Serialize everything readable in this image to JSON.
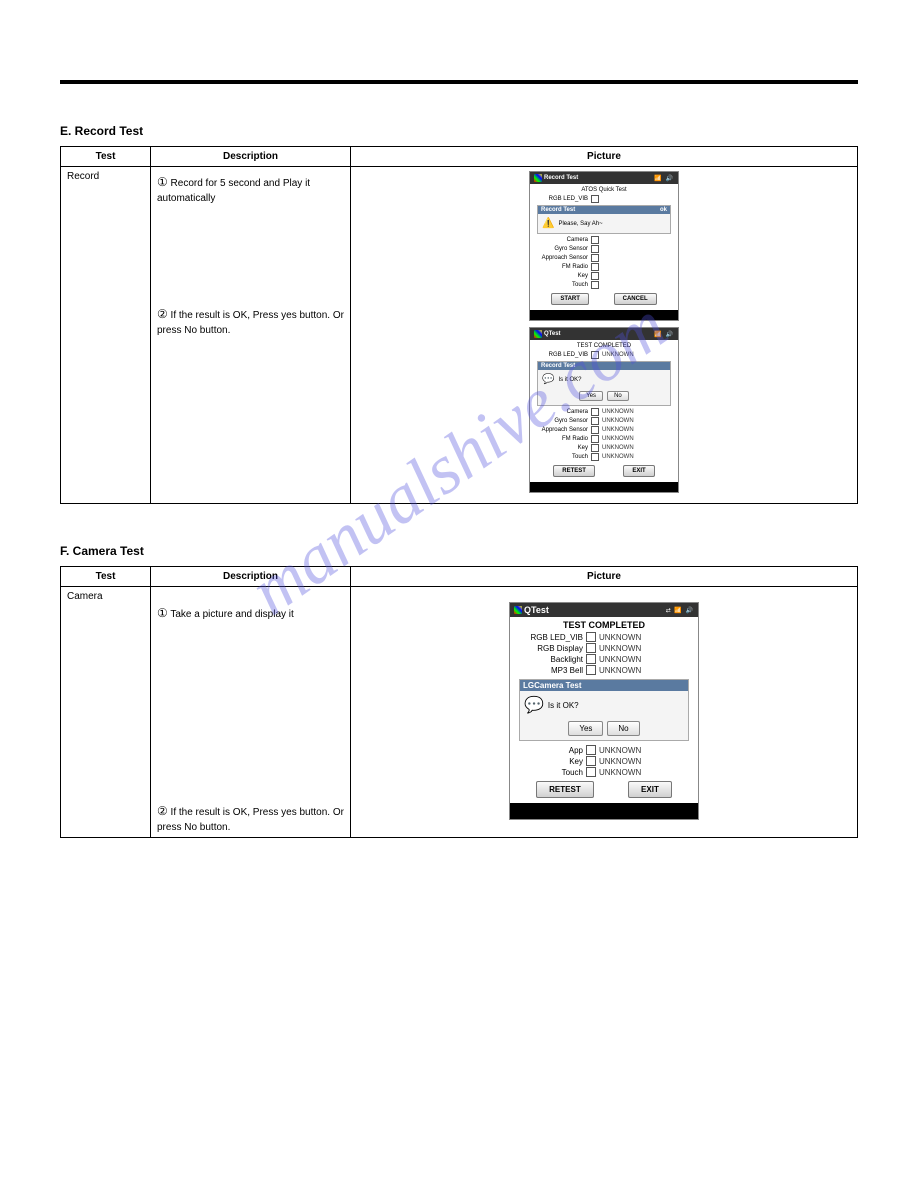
{
  "watermark": "manualshive.com",
  "nums": [
    "①",
    "②"
  ],
  "tableHeaders": [
    "Test",
    "Description",
    "Picture"
  ],
  "sections": [
    {
      "title": "E. Record Test",
      "testName": "Record",
      "steps": [
        "Record for 5 second and Play it automatically",
        "If the result is OK, Press yes button. Or press No button."
      ]
    },
    {
      "title": "F. Camera Test",
      "testName": "Camera",
      "steps": [
        "Take a picture and display it",
        "If the result is OK, Press yes button. Or press No button."
      ]
    }
  ],
  "phones": {
    "record1": {
      "title": "Record Test",
      "subtitle": "ATOS Quick Test",
      "items": [
        "RGB LED_VIB",
        "Camera",
        "Gyro Sensor",
        "Approach Sensor",
        "FM Radio",
        "Key",
        "Touch"
      ],
      "dlgTitle": "Record Test",
      "dlgText": "Please, Say Ah~",
      "btns": [
        "START",
        "CANCEL"
      ]
    },
    "record2": {
      "title": "QTest",
      "subtitle": "TEST COMPLETED",
      "items": [
        "RGB LED_VIB",
        "Camera",
        "Gyro Sensor",
        "Approach Sensor",
        "FM Radio",
        "Key",
        "Touch"
      ],
      "status": "UNKNOWN",
      "dlgTitle": "Record Test",
      "dlgText": "Is it OK?",
      "dlgBtns": [
        "Yes",
        "No"
      ],
      "btns": [
        "RETEST",
        "EXIT"
      ]
    },
    "camera": {
      "title": "QTest",
      "subtitle": "TEST COMPLETED",
      "items": [
        "RGB LED_VIB",
        "RGB Display",
        "Backlight",
        "MP3 Bell",
        "App",
        "Key",
        "Touch"
      ],
      "status": "UNKNOWN",
      "dlgTitle": "LGCamera Test",
      "dlgText": "Is it OK?",
      "dlgBtns": [
        "Yes",
        "No"
      ],
      "btns": [
        "RETEST",
        "EXIT"
      ]
    }
  }
}
